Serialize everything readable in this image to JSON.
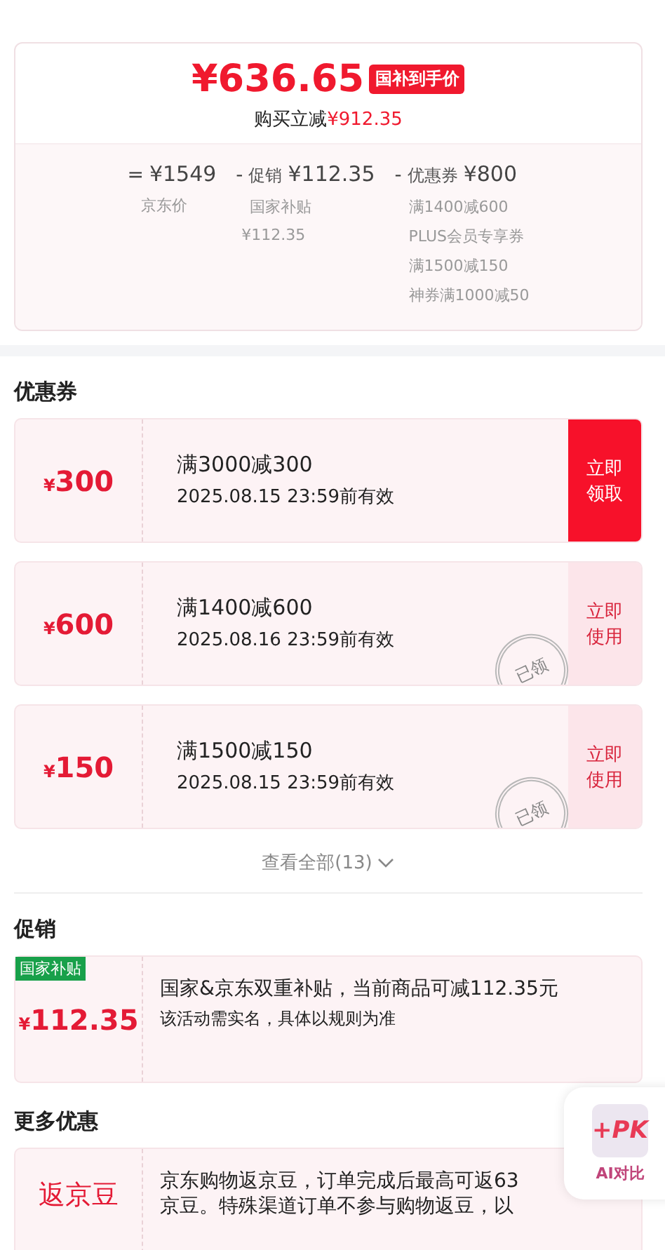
{
  "price_card": {
    "price": "¥636.65",
    "badge": "国补到手价",
    "saving_label": "购买立减",
    "saving_amount": "¥912.35",
    "breakdown": [
      {
        "op": "=",
        "amount": "¥1549",
        "notes": [
          "京东价"
        ]
      },
      {
        "op": "-",
        "label": "促销",
        "amount": "¥112.35",
        "notes": [
          "国家补贴",
          "¥112.35"
        ]
      },
      {
        "op": "-",
        "label": "优惠券",
        "amount": "¥800",
        "notes": [
          "满1400减600",
          "PLUS会员专享券",
          "满1500减150",
          "神券满1000减50"
        ]
      }
    ]
  },
  "coupons": {
    "title": "优惠券",
    "items": [
      {
        "currency": "¥",
        "amount": "300",
        "rule": "满3000减300",
        "validity": "2025.08.15 23:59前有效",
        "claimed": false,
        "action": [
          "立即",
          "领取"
        ]
      },
      {
        "currency": "¥",
        "amount": "600",
        "rule": "满1400减600",
        "validity": "2025.08.16 23:59前有效",
        "claimed": true,
        "stamp": "已领",
        "action": [
          "立即",
          "使用"
        ]
      },
      {
        "currency": "¥",
        "amount": "150",
        "rule": "满1500减150",
        "validity": "2025.08.15 23:59前有效",
        "claimed": true,
        "stamp": "已领",
        "action": [
          "立即",
          "使用"
        ]
      }
    ],
    "view_all": "查看全部(13)"
  },
  "promotion": {
    "title": "促销",
    "tag": "国家补贴",
    "currency": "¥",
    "amount": "112.35",
    "text": "国家&京东双重补贴，当前商品可减112.35元",
    "note": "该活动需实名，具体以规则为准"
  },
  "more": {
    "title": "更多优惠",
    "label": "返京豆",
    "text": "京东购物返京豆，订单完成后最高可返63京豆。特殊渠道订单不参与购物返豆，以"
  },
  "floating": {
    "logo": "+PK",
    "label": "AI对比"
  }
}
